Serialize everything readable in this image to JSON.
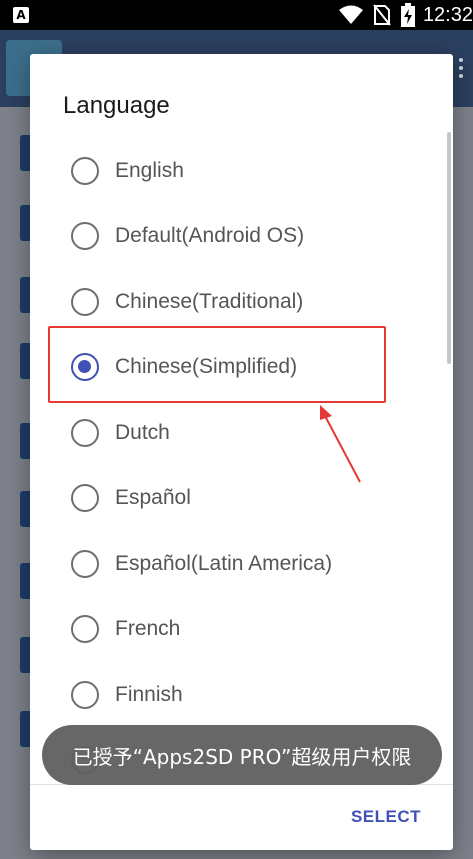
{
  "status_bar": {
    "notification_icon_letter": "A",
    "time": "12:32",
    "icons": [
      "wifi-icon",
      "no-sim-icon",
      "battery-charging-icon"
    ]
  },
  "dialog": {
    "title": "Language",
    "options": [
      {
        "label": "English",
        "checked": false
      },
      {
        "label": "Default(Android OS)",
        "checked": false
      },
      {
        "label": "Chinese(Traditional)",
        "checked": false
      },
      {
        "label": "Chinese(Simplified)",
        "checked": true
      },
      {
        "label": "Dutch",
        "checked": false
      },
      {
        "label": "Español",
        "checked": false
      },
      {
        "label": "Español(Latin America)",
        "checked": false
      },
      {
        "label": "French",
        "checked": false
      },
      {
        "label": "Finnish",
        "checked": false
      }
    ],
    "select_label": "SELECT",
    "accent_color": "#3f51b5"
  },
  "toast": {
    "text": "已授予“Apps2SD PRO”超级用户权限"
  },
  "annotation": {
    "highlight_color": "#e53935",
    "highlighted_option": "Chinese(Simplified)"
  }
}
